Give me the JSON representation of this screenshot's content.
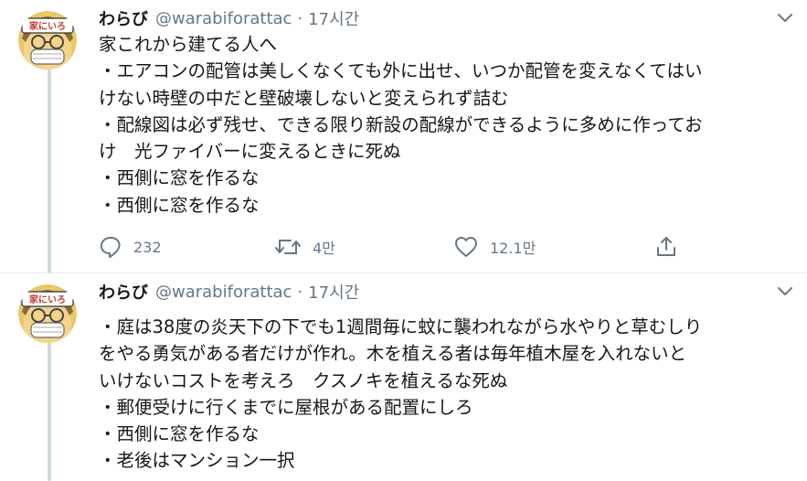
{
  "tweets": [
    {
      "name": "わらび",
      "handle": "@warabiforattac",
      "dot": "·",
      "time": "17시간",
      "avatar_text": "家にいろ",
      "lines": [
        "家これから建てる人へ",
        "・エアコンの配管は美しくなくても外に出せ、いつか配管を変えなくてはい",
        "けない時壁の中だと壁破壊しないと変えられず詰む",
        "・配線図は必ず残せ、できる限り新設の配線ができるように多めに作ってお",
        "け　光ファイバーに変えるときに死ぬ",
        "・西側に窓を作るな",
        "・西側に窓を作るな"
      ],
      "replies": "232",
      "retweets": "4만",
      "likes": "12.1만"
    },
    {
      "name": "わらび",
      "handle": "@warabiforattac",
      "dot": "·",
      "time": "17시간",
      "avatar_text": "家にいろ",
      "lines": [
        "・庭は38度の炎天下の下でも1週間毎に蚊に襲われながら水やりと草むしり",
        "をやる勇気がある者だけが作れ。木を植える者は毎年植木屋を入れないと",
        "いけないコストを考えろ　クスノキを植えるな死ぬ",
        "・郵便受けに行くまでに屋根がある配置にしろ",
        "・西側に窓を作るな",
        "・老後はマンション一択"
      ]
    }
  ]
}
